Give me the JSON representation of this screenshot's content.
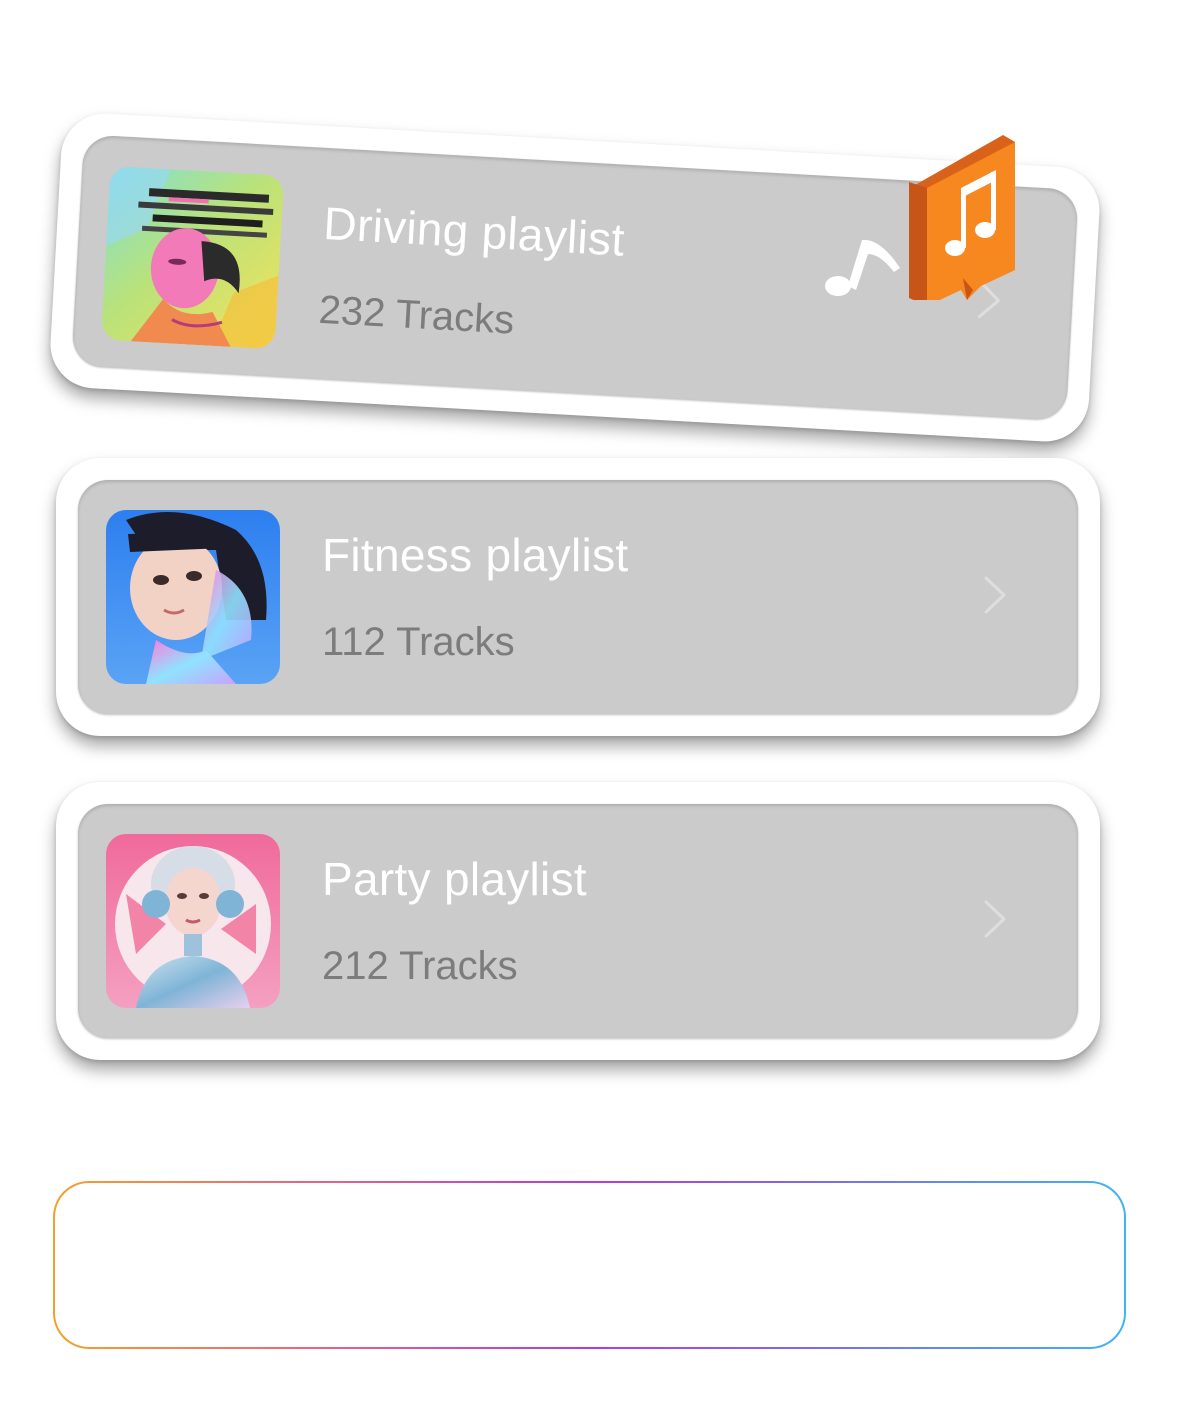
{
  "playlists": [
    {
      "title": "Driving playlist",
      "tracks": "232 Tracks",
      "cover_icon": "glitch-portrait-cover"
    },
    {
      "title": "Fitness playlist",
      "tracks": "112 Tracks",
      "cover_icon": "holographic-girl-cover"
    },
    {
      "title": "Party playlist",
      "tracks": "212 Tracks",
      "cover_icon": "robot-headphones-cover"
    }
  ],
  "icons": {
    "chevron": "chevron-right-icon",
    "music_badge": "music-note-badge-icon",
    "music_note": "music-note-icon"
  },
  "colors": {
    "card_background": "#cbcbcb",
    "card_border": "#ffffff",
    "title_text": "#ffffff",
    "subtitle_text": "#7c7c7c",
    "badge_orange": "#f5841f",
    "gradient_stops": [
      "#f3a12b",
      "#e86a7a",
      "#b43bd9",
      "#7a6cf0",
      "#3fb4f2"
    ]
  }
}
